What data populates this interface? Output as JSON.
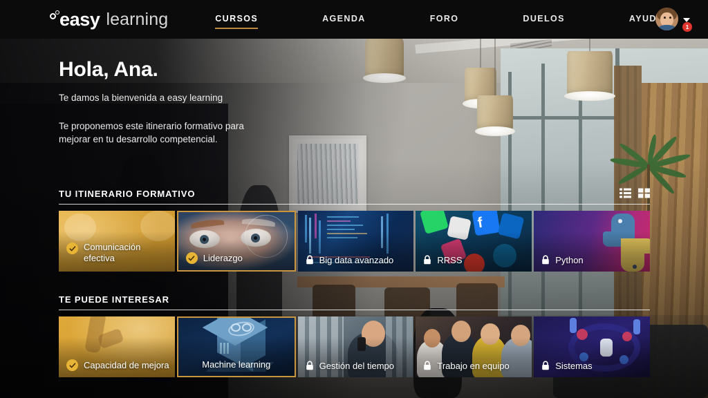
{
  "brand": {
    "logo_primary": "easy",
    "logo_secondary": "learning",
    "logo_mark": "two-circles-mark",
    "accent_color": "#c08a3e",
    "check_color": "#e8b435",
    "badge_color": "#e0342c"
  },
  "nav": {
    "items": [
      {
        "label": "CURSOS",
        "active": true
      },
      {
        "label": "AGENDA",
        "active": false
      },
      {
        "label": "FORO",
        "active": false
      },
      {
        "label": "DUELOS",
        "active": false
      },
      {
        "label": "AYUDA",
        "active": false
      }
    ]
  },
  "user": {
    "avatar_icon": "user-avatar",
    "notification_count": "1",
    "caret_icon": "chevron-down-icon"
  },
  "hero": {
    "greeting": "Hola, Ana.",
    "subtitle": "Te damos la bienvenida a easy learning",
    "paragraph": "Te proponemos este itinerario formativo para mejorar en tu desarrollo competencial."
  },
  "sections": [
    {
      "title": "TU ITINERARIO FORMATIVO",
      "view_toggles": [
        {
          "icon": "list-view-icon",
          "label": "Vista lista"
        },
        {
          "icon": "grid-view-icon",
          "label": "Vista cuadrícula"
        }
      ],
      "cards": [
        {
          "title": "Comunicación efectiva",
          "status_icon": "check-icon",
          "state": "completed",
          "current": false,
          "art": "art-gold"
        },
        {
          "title": "Liderazgo",
          "status_icon": "check-icon",
          "state": "completed",
          "current": true,
          "art": "art-eyes"
        },
        {
          "title": "Big data avanzado",
          "status_icon": "lock-icon",
          "state": "locked",
          "current": false,
          "art": "art-bigdata"
        },
        {
          "title": "RRSS",
          "status_icon": "lock-icon",
          "state": "locked",
          "current": false,
          "art": "art-rrss"
        },
        {
          "title": "Python",
          "status_icon": "lock-icon",
          "state": "locked",
          "current": false,
          "art": "art-python"
        }
      ]
    },
    {
      "title": "TE PUEDE INTERESAR",
      "view_toggles": [],
      "cards": [
        {
          "title": "Capacidad de mejora",
          "status_icon": "check-icon",
          "state": "completed",
          "current": false,
          "art": "art-gold2"
        },
        {
          "title": "Machine learning",
          "status_icon": "none",
          "state": "available",
          "current": true,
          "art": "art-ml"
        },
        {
          "title": "Gestión del tiempo",
          "status_icon": "lock-icon",
          "state": "locked",
          "current": false,
          "art": "art-gestion"
        },
        {
          "title": "Trabajo en equipo",
          "status_icon": "lock-icon",
          "state": "locked",
          "current": false,
          "art": "art-equipo"
        },
        {
          "title": "Sistemas",
          "status_icon": "lock-icon",
          "state": "locked",
          "current": false,
          "art": "art-sistemas"
        }
      ]
    }
  ]
}
